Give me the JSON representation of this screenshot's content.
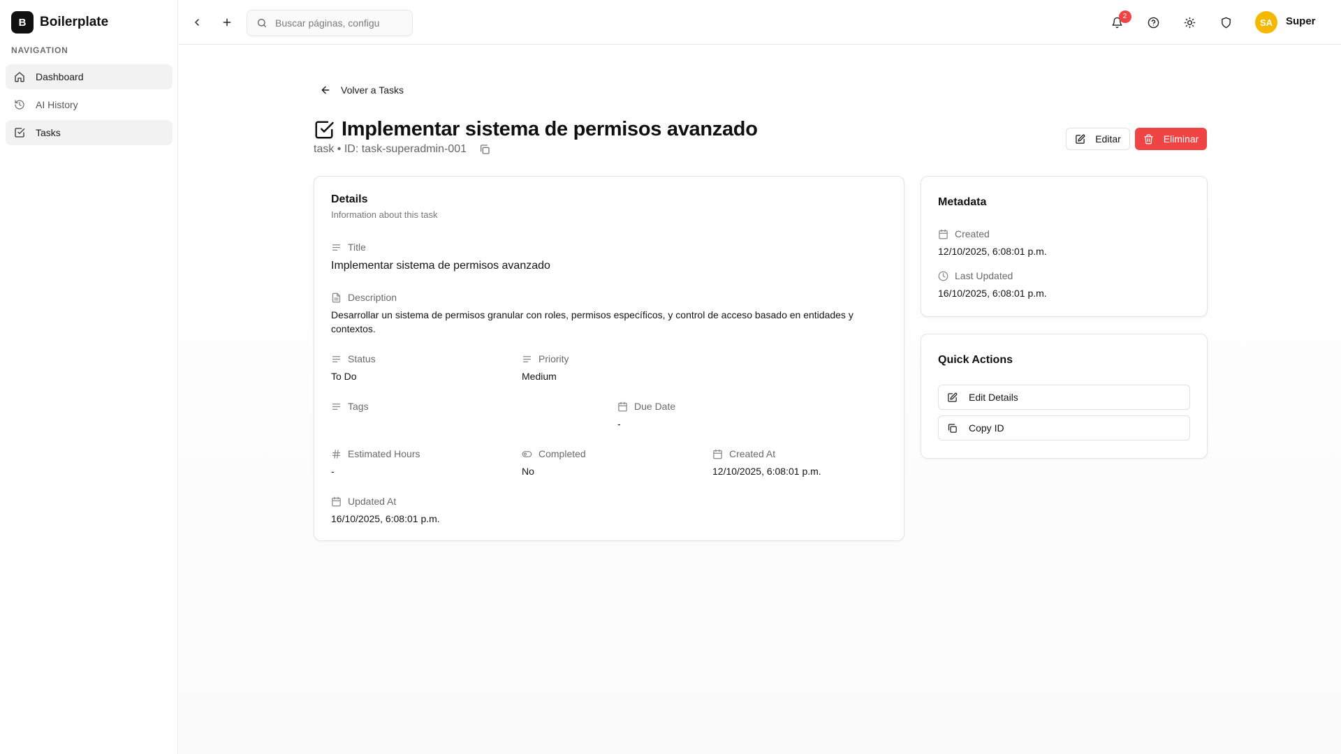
{
  "sidebar": {
    "brand_initial": "B",
    "brand_name": "Boilerplate",
    "section_label": "NAVIGATION",
    "items": [
      {
        "label": "Dashboard",
        "icon": "home-icon"
      },
      {
        "label": "AI History",
        "icon": "history-icon"
      },
      {
        "label": "Tasks",
        "icon": "checkbox-icon"
      }
    ]
  },
  "topbar": {
    "search_placeholder": "Buscar páginas, configu",
    "notification_count": "2",
    "avatar_initials": "SA",
    "user_name": "Super"
  },
  "page": {
    "back_label": "Volver a Tasks",
    "title": "Implementar sistema de permisos avanzado",
    "subtitle": "task • ID: task-superadmin-001",
    "edit_label": "Editar",
    "delete_label": "Eliminar"
  },
  "details": {
    "title": "Details",
    "description": "Information about this task",
    "fields": {
      "title": {
        "label": "Title",
        "value": "Implementar sistema de permisos avanzado"
      },
      "description": {
        "label": "Description",
        "value": "Desarrollar un sistema de permisos granular con roles, permisos específicos, y control de acceso basado en entidades y contextos."
      },
      "status": {
        "label": "Status",
        "value": "To Do"
      },
      "priority": {
        "label": "Priority",
        "value": "Medium"
      },
      "tags": {
        "label": "Tags",
        "value": ""
      },
      "due_date": {
        "label": "Due Date",
        "value": "-"
      },
      "estimated_hours": {
        "label": "Estimated Hours",
        "value": "-"
      },
      "completed": {
        "label": "Completed",
        "value": "No"
      },
      "created_at": {
        "label": "Created At",
        "value": "12/10/2025, 6:08:01 p.m."
      },
      "updated_at": {
        "label": "Updated At",
        "value": "16/10/2025, 6:08:01 p.m."
      }
    }
  },
  "metadata": {
    "title": "Metadata",
    "created_label": "Created",
    "created_value": "12/10/2025, 6:08:01 p.m.",
    "updated_label": "Last Updated",
    "updated_value": "16/10/2025, 6:08:01 p.m."
  },
  "quick_actions": {
    "title": "Quick Actions",
    "edit_details": "Edit Details",
    "copy_id": "Copy ID"
  },
  "colors": {
    "danger": "#ef4444",
    "avatar": "#f5b800",
    "brand": "#111111"
  }
}
